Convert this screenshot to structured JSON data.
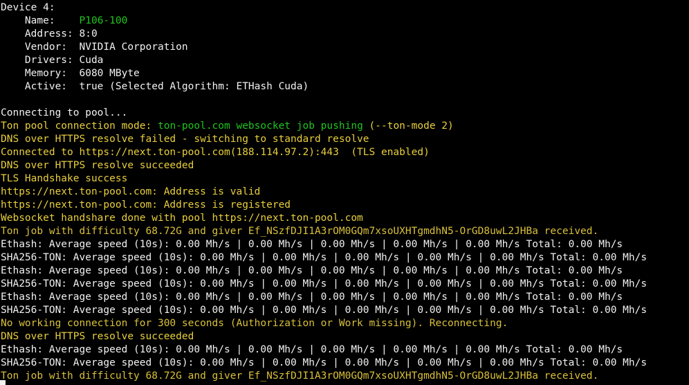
{
  "colors": {
    "background": "#000000",
    "default_text": "#f2f2f2",
    "green": "#1fc51f",
    "yellow": "#e8cf3c"
  },
  "device": {
    "header": "Device 4:",
    "name_label": "    Name:    ",
    "name_value": "P106-100",
    "address": "    Address: 8:0",
    "vendor": "    Vendor:  NVIDIA Corporation",
    "drivers": "    Drivers: Cuda",
    "memory": "    Memory:  6080 MByte",
    "active": "    Active:  true (Selected Algorithm: ETHash Cuda)"
  },
  "log": {
    "connecting": "Connecting to pool...",
    "mode_prefix": "Ton pool connection mode: ",
    "mode_value": "ton-pool.com websocket job pushing",
    "mode_suffix": " (--ton-mode 2)",
    "doh_failed": "DNS over HTTPS resolve failed - switching to standard resolve",
    "connected": "Connected to https://next.ton-pool.com(188.114.97.2):443  (TLS enabled)",
    "doh_ok_1": "DNS over HTTPS resolve succeeded",
    "tls": "TLS Handshake success",
    "addr_valid": "https://next.ton-pool.com: Address is valid",
    "addr_registered": "https://next.ton-pool.com: Address is registered",
    "ws_done": "Websocket handshare done with pool https://next.ton-pool.com",
    "job_1": "Ton job with difficulty 68.72G and giver Ef_NSzfDJI1A3rOM0GQm7xsoUXHTgmdhN5-OrGD8uwL2JHBa received.",
    "eth_1": "Ethash: Average speed (10s): 0.00 Mh/s | 0.00 Mh/s | 0.00 Mh/s | 0.00 Mh/s | 0.00 Mh/s Total: 0.00 Mh/s",
    "sha_1": "SHA256-TON: Average speed (10s): 0.00 Mh/s | 0.00 Mh/s | 0.00 Mh/s | 0.00 Mh/s | 0.00 Mh/s Total: 0.00 Mh/s",
    "eth_2": "Ethash: Average speed (10s): 0.00 Mh/s | 0.00 Mh/s | 0.00 Mh/s | 0.00 Mh/s | 0.00 Mh/s Total: 0.00 Mh/s",
    "sha_2": "SHA256-TON: Average speed (10s): 0.00 Mh/s | 0.00 Mh/s | 0.00 Mh/s | 0.00 Mh/s | 0.00 Mh/s Total: 0.00 Mh/s",
    "eth_3": "Ethash: Average speed (10s): 0.00 Mh/s | 0.00 Mh/s | 0.00 Mh/s | 0.00 Mh/s | 0.00 Mh/s Total: 0.00 Mh/s",
    "sha_3": "SHA256-TON: Average speed (10s): 0.00 Mh/s | 0.00 Mh/s | 0.00 Mh/s | 0.00 Mh/s | 0.00 Mh/s Total: 0.00 Mh/s",
    "no_conn": "No working connection for 300 seconds (Authorization or Work missing). Reconnecting.",
    "doh_ok_2": "DNS over HTTPS resolve succeeded",
    "eth_4": "Ethash: Average speed (10s): 0.00 Mh/s | 0.00 Mh/s | 0.00 Mh/s | 0.00 Mh/s | 0.00 Mh/s Total: 0.00 Mh/s",
    "sha_4": "SHA256-TON: Average speed (10s): 0.00 Mh/s | 0.00 Mh/s | 0.00 Mh/s | 0.00 Mh/s | 0.00 Mh/s Total: 0.00 Mh/s",
    "job_2": "Ton job with difficulty 68.72G and giver Ef_NSzfDJI1A3rOM0GQm7xsoUXHTgmdhN5-OrGD8uwL2JHBa received."
  }
}
